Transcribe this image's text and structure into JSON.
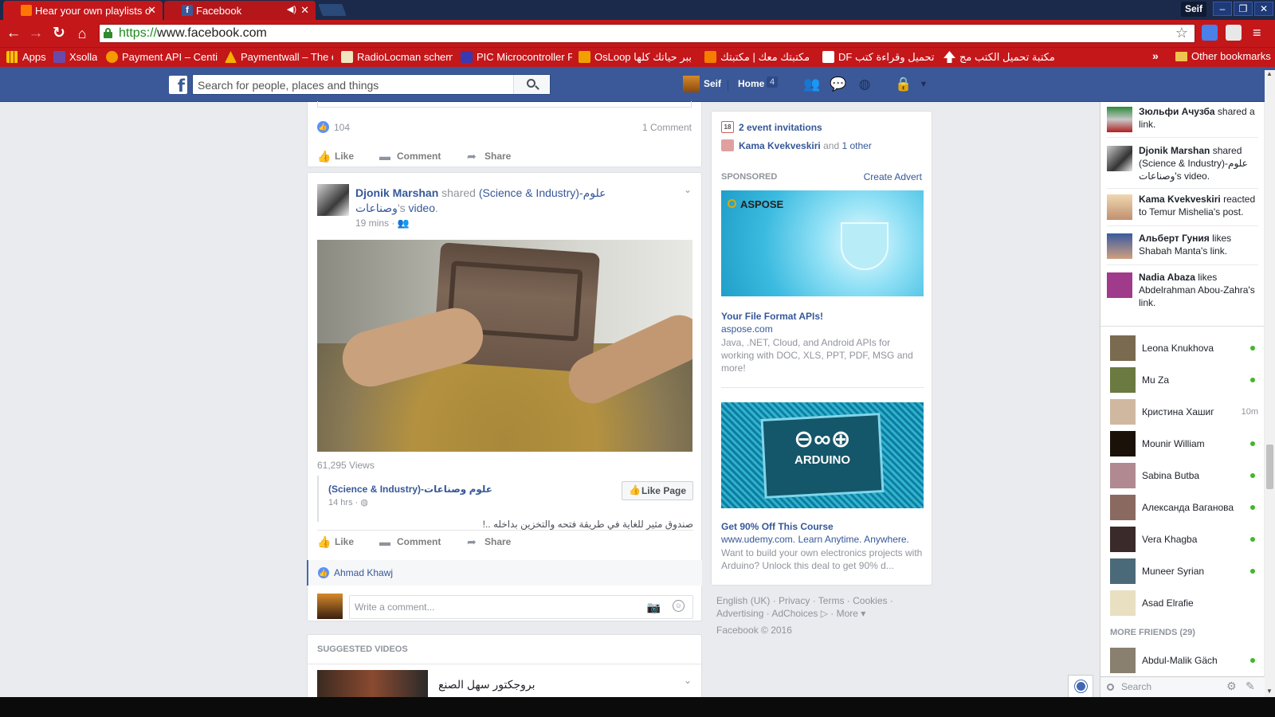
{
  "browser": {
    "tabs": [
      {
        "title": "Hear your own playlists o"
      },
      {
        "title": "Facebook"
      }
    ],
    "profile": "Seif",
    "url_scheme": "https://",
    "url_host": "www.facebook.com",
    "bookmarks": [
      {
        "label": "Apps"
      },
      {
        "label": "Xsolla"
      },
      {
        "label": "Payment API – Centi"
      },
      {
        "label": "Paymentwall – The e"
      },
      {
        "label": "RadioLocman schem"
      },
      {
        "label": "PIC Microcontroller F"
      },
      {
        "label": "OsLoop ببر حياتك كلها"
      },
      {
        "label": "مكتبتك معك | مكتبتك"
      },
      {
        "label": "DF تحميل وقراءة كتب"
      },
      {
        "label": "مكتبة تحميل الكتب مج"
      }
    ],
    "more_bookmarks": "»",
    "other_bookmarks": "Other bookmarks",
    "accent": "#c4171a"
  },
  "fb": {
    "brand_color": "#3b5998",
    "search_placeholder": "Search for people, places and things",
    "profile_name": "Seif",
    "home_label": "Home",
    "home_count": "4"
  },
  "post1": {
    "likes": "104",
    "comments": "1 Comment"
  },
  "actions": {
    "like": "Like",
    "comment": "Comment",
    "share": "Share"
  },
  "post2": {
    "author": "Djonik Marshan",
    "shared": "shared",
    "page_link": "(Science & Industry)-علوم وصناعات",
    "possessive": "'s",
    "object": "video",
    "period": ".",
    "time": "19 mins ·",
    "views": "61,295 Views",
    "page_name": "(Science & Industry)-علوم وصناعات",
    "page_time": "14 hrs ·",
    "like_page": "Like Page",
    "description": "صندوق مثير للغاية في طريقة فتحه والتخزين بداخله ..!",
    "liked_by": "Ahmad Khawj",
    "comment_placeholder": "Write a comment..."
  },
  "suggested": {
    "title": "SUGGESTED VIDEOS",
    "video_title": "بروجكتور سهل الصنع"
  },
  "right": {
    "events": "2 event invitations",
    "birthday_name": "Kama Kvekveskiri",
    "birthday_rest": "and",
    "birthday_other": "1 other",
    "sponsored": "SPONSORED",
    "create_advert": "Create Advert",
    "ad1": {
      "brand": "ASPOSE",
      "title": "Your File Format APIs!",
      "domain": "aspose.com",
      "description": "Java, .NET, Cloud, and Android APIs for working with DOC, XLS, PPT, PDF, MSG and more!"
    },
    "ad2": {
      "brand": "ARDUINO",
      "title": "Get 90% Off This Course",
      "domain": "www.udemy.com. Learn Anytime. Anywhere.",
      "description": "Want to build your own electronics projects with Arduino? Unlock this deal to get 90% d..."
    },
    "footer_links": "English (UK) · Privacy · Terms · Cookies · Advertising · AdChoices ▷ · More ▾",
    "copyright": "Facebook © 2016"
  },
  "ticker": [
    {
      "name": "Зюльфи Ачузба",
      "text": "shared a link."
    },
    {
      "name": "Djonik Marshan",
      "text": "shared (Science & Industry)-علوم وصناعات's video."
    },
    {
      "name": "Kama Kvekveskiri",
      "text": "reacted to Temur Mishelia's post."
    },
    {
      "name": "Альберт Гуния",
      "text": "likes Shabah Manta's link."
    },
    {
      "name": "Nadia Abaza",
      "text": "likes Abdelrahman Abou-Zahra's link."
    }
  ],
  "chat": [
    {
      "name": "Leona Knukhova",
      "status": "online"
    },
    {
      "name": "Mu Za",
      "status": "online"
    },
    {
      "name": "Кристина Хашиг",
      "status": "10m"
    },
    {
      "name": "Mounir William",
      "status": "online"
    },
    {
      "name": "Sabina Butba",
      "status": "online"
    },
    {
      "name": "Александа Ваганова",
      "status": "online"
    },
    {
      "name": "Vera Khagba",
      "status": "online"
    },
    {
      "name": "Muneer Syrian",
      "status": "online"
    },
    {
      "name": "Asad Elrafie",
      "status": ""
    }
  ],
  "more_friends": "MORE FRIENDS (29)",
  "more_friend_1": "Abdul-Malik Gäch",
  "chat_search_placeholder": "Search"
}
